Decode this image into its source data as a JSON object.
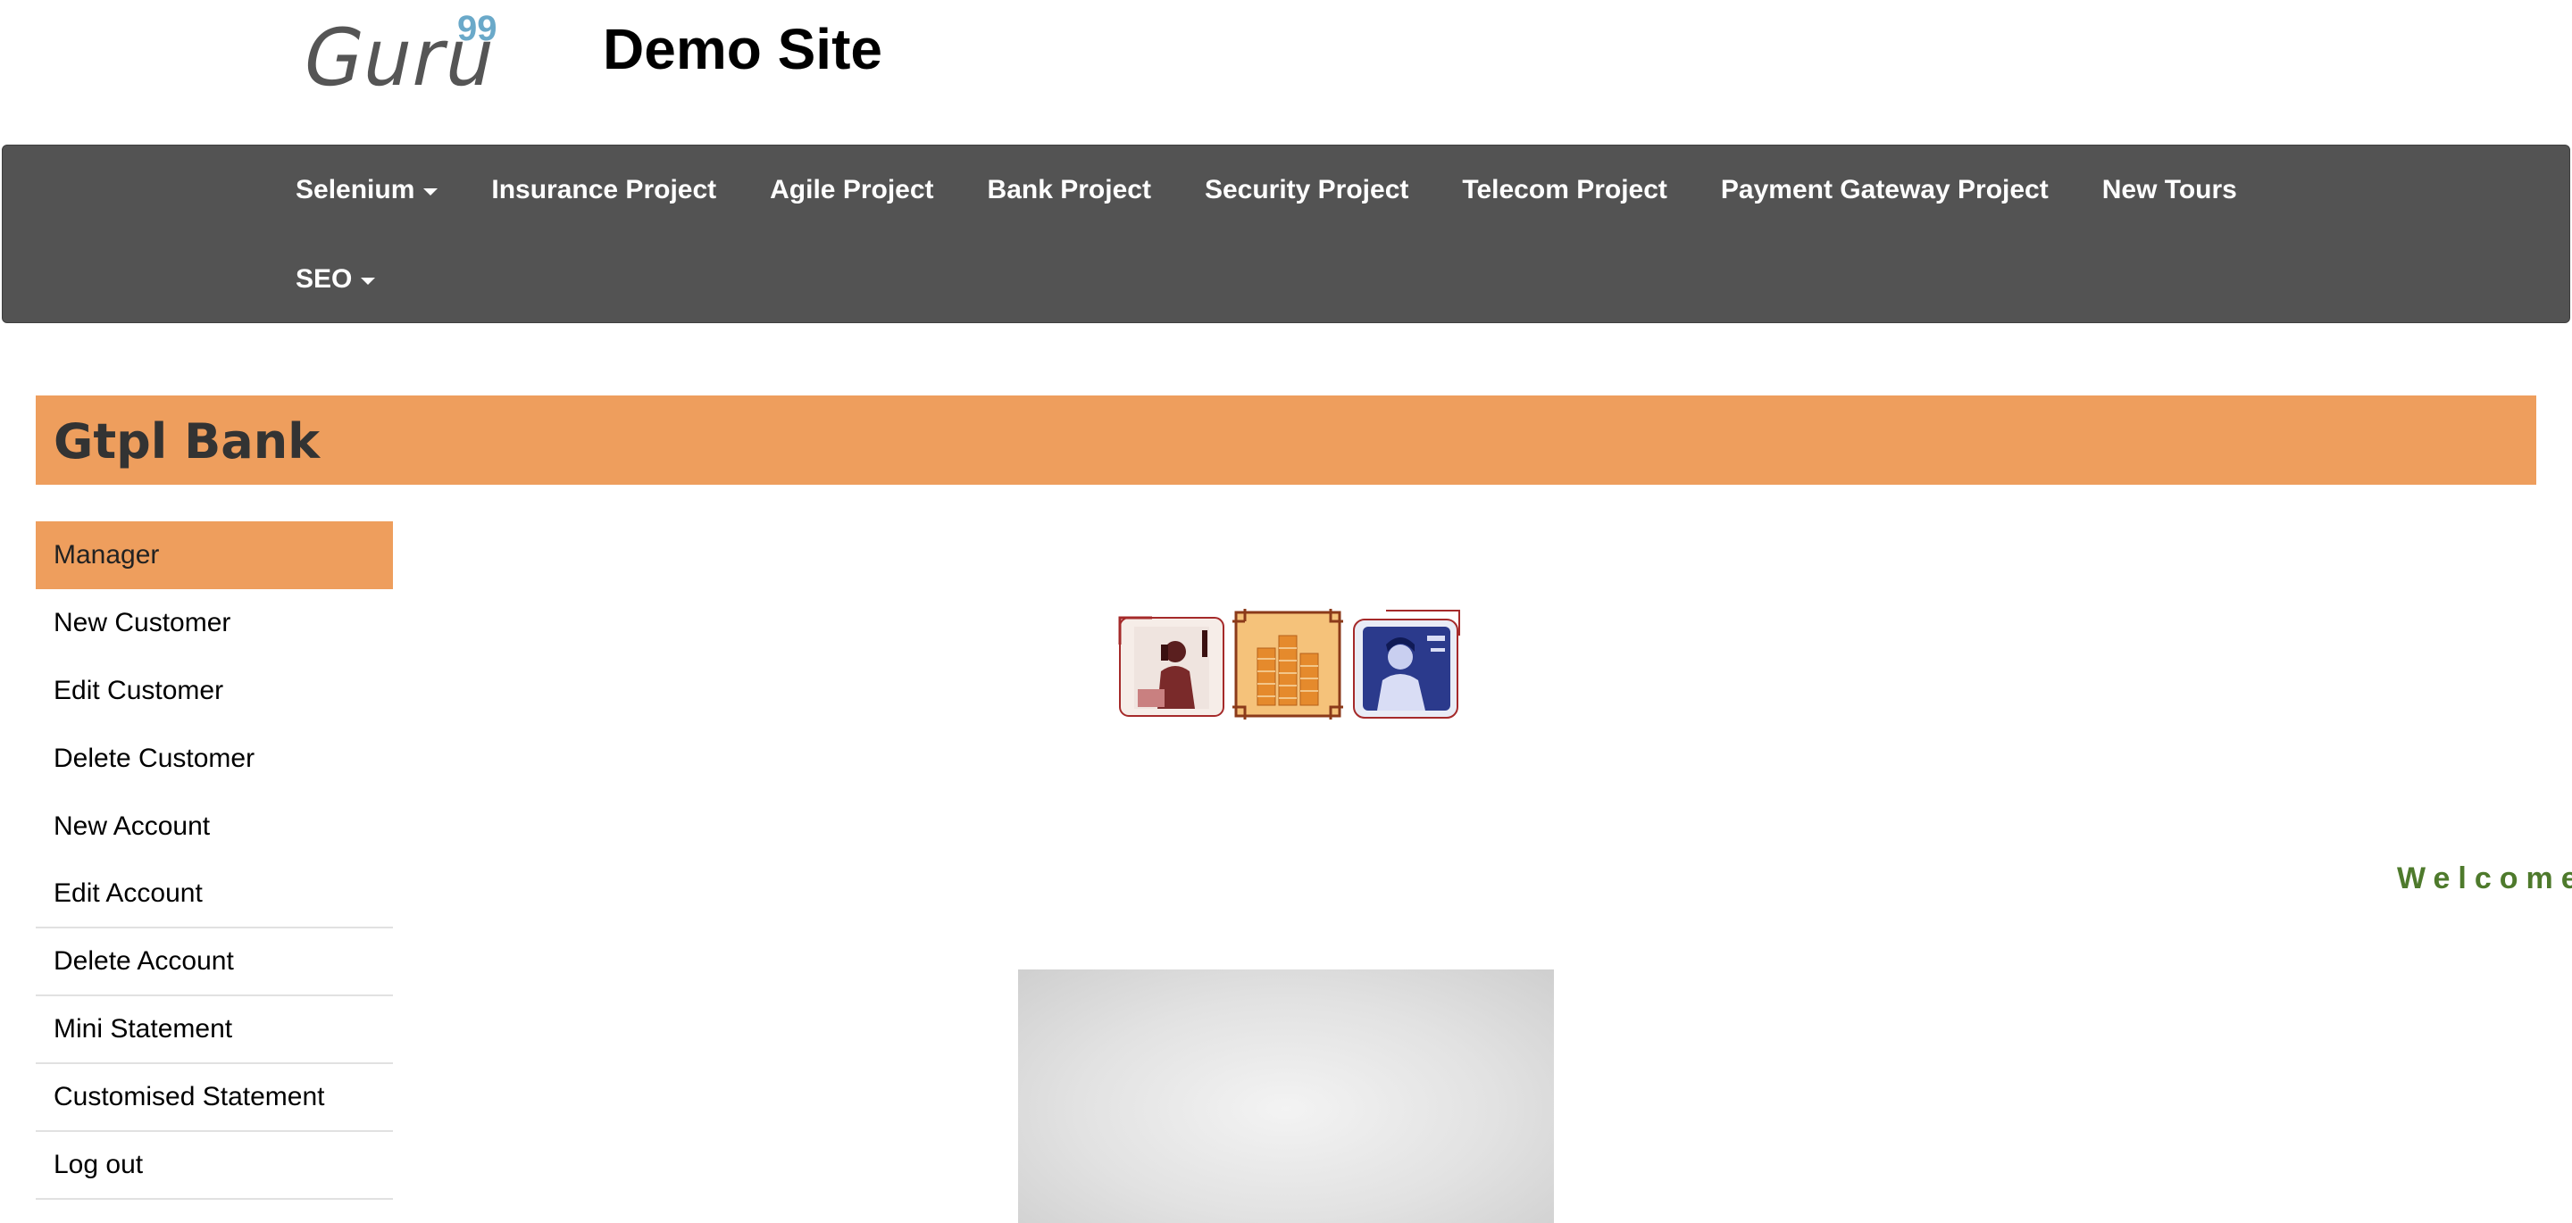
{
  "brand": {
    "logo_text": "Guru",
    "logo_superscript": "99",
    "site_title": "Demo Site"
  },
  "nav": {
    "row1": [
      "Selenium",
      "Insurance Project",
      "Agile Project",
      "Bank Project",
      "Security Project",
      "Telecom Project",
      "Payment Gateway Project",
      "New Tours"
    ],
    "row2": [
      "SEO"
    ]
  },
  "bank": {
    "title": "Gtpl Bank"
  },
  "sidebar": {
    "items": [
      {
        "label": "Manager"
      },
      {
        "label": "New Customer"
      },
      {
        "label": "Edit Customer"
      },
      {
        "label": "Delete Customer"
      },
      {
        "label": "New Account"
      },
      {
        "label": "Edit Account"
      },
      {
        "label": "Delete Account"
      },
      {
        "label": "Mini Statement"
      },
      {
        "label": "Customised Statement"
      },
      {
        "label": "Log out"
      }
    ]
  },
  "welcome_text": "Welcome",
  "colors": {
    "accent": "#ee9e5d",
    "navbar": "#535353",
    "welcome": "#4e7a2c",
    "logo_sup": "#6aa9c9"
  }
}
